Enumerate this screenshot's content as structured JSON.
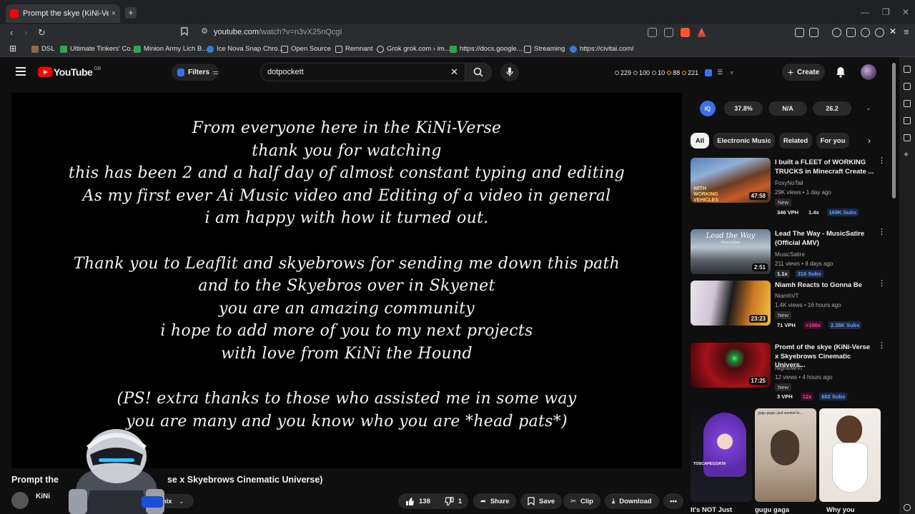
{
  "browser": {
    "tab_title": "Prompt the skye (KiNi-Verse x Sk",
    "tab_close": "×",
    "new_tab": "+",
    "url_host": "youtube.com",
    "url_path": "/watch?v=n3vX25nQcgI",
    "bookmarks": [
      {
        "label": "DSL",
        "color": "#8a6d3b"
      },
      {
        "label": "Ultimate Tinkers' Co...",
        "color": "#2aa84a"
      },
      {
        "label": "Minion Army Lich B...",
        "color": "#2aa84a"
      },
      {
        "label": "Ice Nova Snap Chro...",
        "color": "#3a7bd5"
      },
      {
        "label": "Open Source",
        "color": "folder"
      },
      {
        "label": "Remnant",
        "color": "folder"
      },
      {
        "label": "Grok grok.com › im...",
        "color": "#dddddd"
      },
      {
        "label": "https://docs.google...",
        "color": "#2aa84a"
      },
      {
        "label": "Streaming",
        "color": "folder"
      },
      {
        "label": "https://civitai.com/",
        "color": "#3a7bd5"
      }
    ]
  },
  "header": {
    "logo_text": "YouTube",
    "logo_region": "GB",
    "filters_label": "Filters",
    "search_value": "dotpockett",
    "stats": [
      "229",
      "100",
      "10",
      "88",
      "221"
    ],
    "create_label": "Create"
  },
  "video": {
    "caption_lines": [
      "From everyone here in the KiNi-Verse",
      "thank you for watching",
      "this has been 2 and a half day of almost constant typing and editing",
      "As my first ever Ai Music video and Editing of a video in general",
      "i am happy with how it turned out.",
      "",
      "Thank you to Leaflit and skyebrows for sending me down this path",
      "and to the Skyebros over in Skyenet",
      "you are an amazing community",
      "i hope to add more of you to my next projects",
      "with love from KiNi the Hound",
      "",
      "(PS! extra thanks to those who assisted me in some way",
      "you are many and you know who you are *head pats*)"
    ],
    "title_left": "Prompt the",
    "title_right": "se x Skyebrows Cinematic Universe)",
    "channel_name": "KiNi",
    "remix_label": "Remix",
    "likes": "138",
    "dislikes": "1",
    "share_label": "Share",
    "save_label": "Save",
    "clip_label": "Clip",
    "download_label": "Download"
  },
  "sidebar": {
    "iq_badge": "IQ",
    "iq_stats": [
      "37.8%",
      "N/A",
      "26.2"
    ],
    "chips": [
      "All",
      "Electronic Music",
      "Related",
      "For you"
    ],
    "recommendations": [
      {
        "title": "I built a FLEET of WORKING TRUCKS in Minecraft Create ...",
        "channel": "FoxyNoTail",
        "meta": "29K views • 1 day ago",
        "new": "New",
        "duration": "47:58",
        "b1": "346 VPH",
        "b2": "1.4x",
        "b3": "168K Subs"
      },
      {
        "title": "Lead The Way - MusicSatire (Official AMV)",
        "channel": "MusicSatire",
        "meta": "211 views • 8 days ago",
        "new": "",
        "duration": "2:51",
        "b1": "1.1x",
        "b2": "316 Subs",
        "b3": ""
      },
      {
        "title": "Niamh Reacts to Gonna Be",
        "channel": "NiamhVT",
        "meta": "1.4K views • 16 hours ago",
        "new": "New",
        "duration": "23:23",
        "b1": "71 VPH",
        "b2": ">100x",
        "b3": "2.35K Subs"
      },
      {
        "title": "Promt of the skye (KiNi-Verse x Skyebrows Cinematic Univers...",
        "channel": "NightowlVt",
        "meta": "12 views • 4 hours ago",
        "new": "New",
        "duration": "17:25",
        "b1": "3 VPH",
        "b2": "12x",
        "b3": "602 Subs"
      }
    ],
    "thumb_text": {
      "truck": "WITH WORKING VEHICLES",
      "lead": "Lead the Way",
      "lead_sub": "MusicSatire"
    },
    "shorts": [
      {
        "title": "It's NOT Just",
        "overlay": "TOSCAPEGOATA"
      },
      {
        "title": "gugu gaga",
        "overlay": "gugu gaga i just wanted to..."
      },
      {
        "title": "Why you",
        "overlay": ""
      }
    ]
  }
}
